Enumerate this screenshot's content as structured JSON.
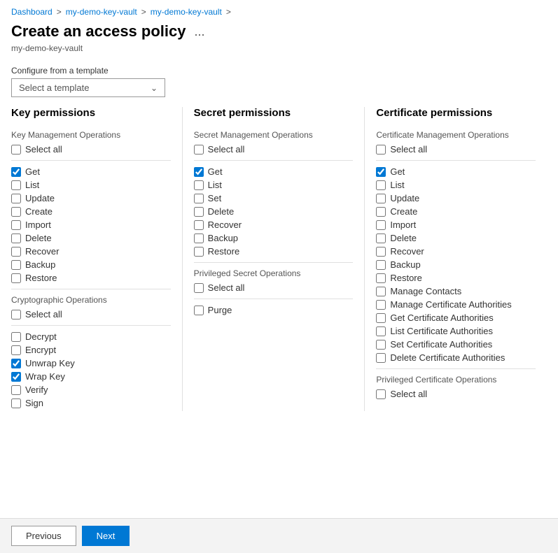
{
  "breadcrumb": {
    "items": [
      "Dashboard",
      "my-demo-key-vault",
      "my-demo-key-vault"
    ],
    "separators": [
      ">",
      ">",
      ">"
    ]
  },
  "header": {
    "title": "Create an access policy",
    "subtitle": "my-demo-key-vault",
    "ellipsis": "..."
  },
  "template": {
    "label": "Configure from a template",
    "placeholder": "Select a template"
  },
  "columns": {
    "key": {
      "title": "Key permissions",
      "sections": [
        {
          "name": "Key Management Operations",
          "items": [
            {
              "label": "Select all",
              "checked": false
            },
            {
              "label": "Get",
              "checked": true
            },
            {
              "label": "List",
              "checked": false
            },
            {
              "label": "Update",
              "checked": false
            },
            {
              "label": "Create",
              "checked": false
            },
            {
              "label": "Import",
              "checked": false
            },
            {
              "label": "Delete",
              "checked": false
            },
            {
              "label": "Recover",
              "checked": false
            },
            {
              "label": "Backup",
              "checked": false
            },
            {
              "label": "Restore",
              "checked": false
            }
          ]
        },
        {
          "name": "Cryptographic Operations",
          "items": [
            {
              "label": "Select all",
              "checked": false
            },
            {
              "label": "Decrypt",
              "checked": false
            },
            {
              "label": "Encrypt",
              "checked": false
            },
            {
              "label": "Unwrap Key",
              "checked": true
            },
            {
              "label": "Wrap Key",
              "checked": true
            },
            {
              "label": "Verify",
              "checked": false
            },
            {
              "label": "Sign",
              "checked": false
            }
          ]
        }
      ]
    },
    "secret": {
      "title": "Secret permissions",
      "sections": [
        {
          "name": "Secret Management Operations",
          "items": [
            {
              "label": "Select all",
              "checked": false
            },
            {
              "label": "Get",
              "checked": true
            },
            {
              "label": "List",
              "checked": false
            },
            {
              "label": "Set",
              "checked": false
            },
            {
              "label": "Delete",
              "checked": false
            },
            {
              "label": "Recover",
              "checked": false
            },
            {
              "label": "Backup",
              "checked": false
            },
            {
              "label": "Restore",
              "checked": false
            }
          ]
        },
        {
          "name": "Privileged Secret Operations",
          "items": [
            {
              "label": "Select all",
              "checked": false
            },
            {
              "label": "Purge",
              "checked": false
            }
          ]
        }
      ]
    },
    "certificate": {
      "title": "Certificate permissions",
      "sections": [
        {
          "name": "Certificate Management Operations",
          "items": [
            {
              "label": "Select all",
              "checked": false
            },
            {
              "label": "Get",
              "checked": true
            },
            {
              "label": "List",
              "checked": false
            },
            {
              "label": "Update",
              "checked": false
            },
            {
              "label": "Create",
              "checked": false
            },
            {
              "label": "Import",
              "checked": false
            },
            {
              "label": "Delete",
              "checked": false
            },
            {
              "label": "Recover",
              "checked": false
            },
            {
              "label": "Backup",
              "checked": false
            },
            {
              "label": "Restore",
              "checked": false
            },
            {
              "label": "Manage Contacts",
              "checked": false
            },
            {
              "label": "Manage Certificate Authorities",
              "checked": false
            },
            {
              "label": "Get Certificate Authorities",
              "checked": false
            },
            {
              "label": "List Certificate Authorities",
              "checked": false
            },
            {
              "label": "Set Certificate Authorities",
              "checked": false
            },
            {
              "label": "Delete Certificate Authorities",
              "checked": false
            }
          ]
        },
        {
          "name": "Privileged Certificate Operations",
          "items": [
            {
              "label": "Select all",
              "checked": false
            }
          ]
        }
      ]
    }
  },
  "footer": {
    "previous_label": "Previous",
    "next_label": "Next"
  }
}
